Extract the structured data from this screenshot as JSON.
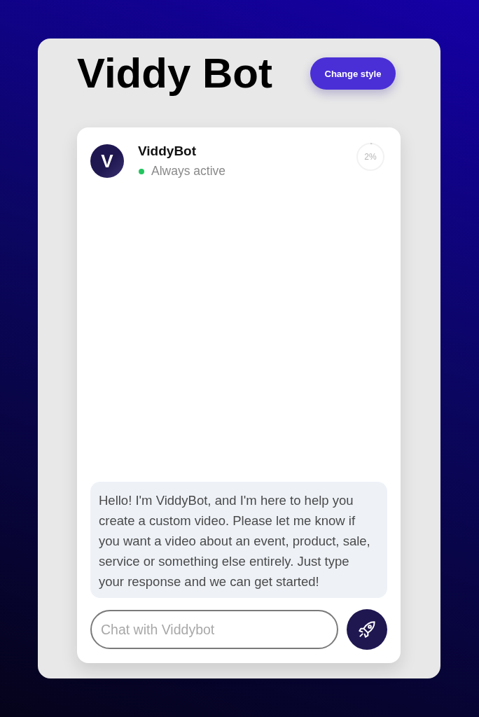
{
  "header": {
    "title": "Viddy Bot",
    "style_button": "Change style"
  },
  "chat": {
    "bot": {
      "avatar_letter": "V",
      "name": "ViddyBot",
      "status": "Always active",
      "online": true
    },
    "progress": {
      "level": 0.02,
      "reading": "2%"
    },
    "messages": [
      {
        "kind": "bot",
        "text": "Hello! I'm ViddyBot, and I'm here to help you create a custom video. Please let me know if you want a video about an event, product, sale, service or something else entirely. Just type your response and we can get started!"
      }
    ],
    "input": {
      "placeholder": "Chat with Viddybot"
    }
  }
}
